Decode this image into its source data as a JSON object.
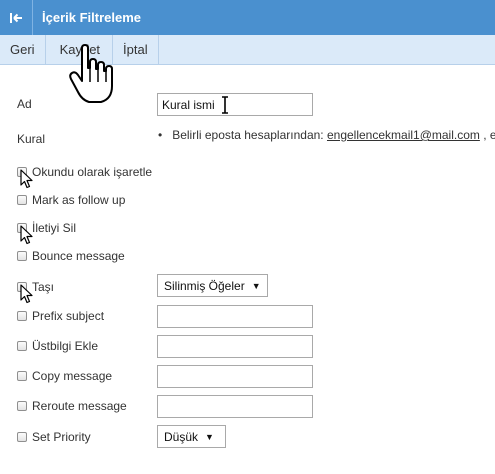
{
  "titlebar": {
    "title": "İçerik Filtreleme",
    "back_icon": "arrow-to-left-icon"
  },
  "toolbar": {
    "back": "Geri",
    "save": "Kaydet",
    "cancel": "İptal"
  },
  "form": {
    "name_label": "Ad",
    "name_value": "Kural ismi",
    "rule_label": "Kural",
    "rule_text": "Belirli eposta hesaplarından:",
    "rule_link": "engellencekmail1@mail.com",
    "rule_tail": ", e"
  },
  "actions": {
    "mark_read": "Okundu olarak işaretle",
    "follow_up": "Mark as follow up",
    "delete": "İletiyi Sil",
    "bounce": "Bounce message",
    "move": "Taşı",
    "move_folder": "Silinmiş Öğeler",
    "prefix": "Prefix subject",
    "add_header": "Üstbilgi Ekle",
    "copy": "Copy message",
    "reroute": "Reroute message",
    "priority": "Set Priority",
    "priority_value": "Düşük"
  },
  "colors": {
    "header_bg": "#4a90cf",
    "toolbar_bg": "#dbeaf9"
  }
}
